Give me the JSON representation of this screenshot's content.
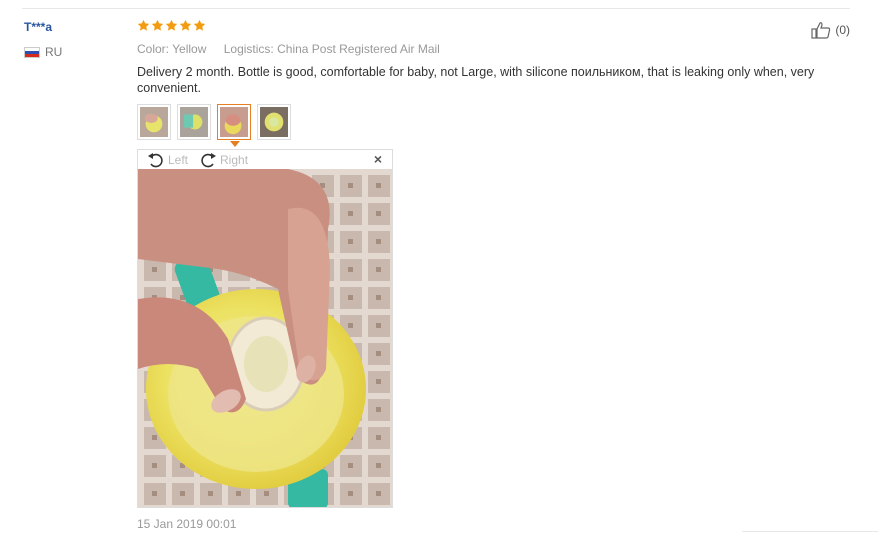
{
  "review": {
    "user_name": "T***a",
    "country": "RU",
    "rating": 5,
    "color_label": "Color:",
    "color_value": "Yellow",
    "logistics_label": "Logistics:",
    "logistics_value": "China Post Registered Air Mail",
    "text": "Delivery 2 month. Bottle is good, comfortable for baby, not Large, with silicone поильником, that is leaking only when, very convenient.",
    "helpful_count": "(0)",
    "date": "15 Jan 2019 00:01"
  },
  "viewer": {
    "rotate_left": "Left",
    "rotate_right": "Right",
    "close": "×",
    "active_thumbnail": 3
  },
  "colors": {
    "star": "#f39c12",
    "username": "#2a56a0",
    "active_border": "#e67e22",
    "muted": "#999999"
  }
}
